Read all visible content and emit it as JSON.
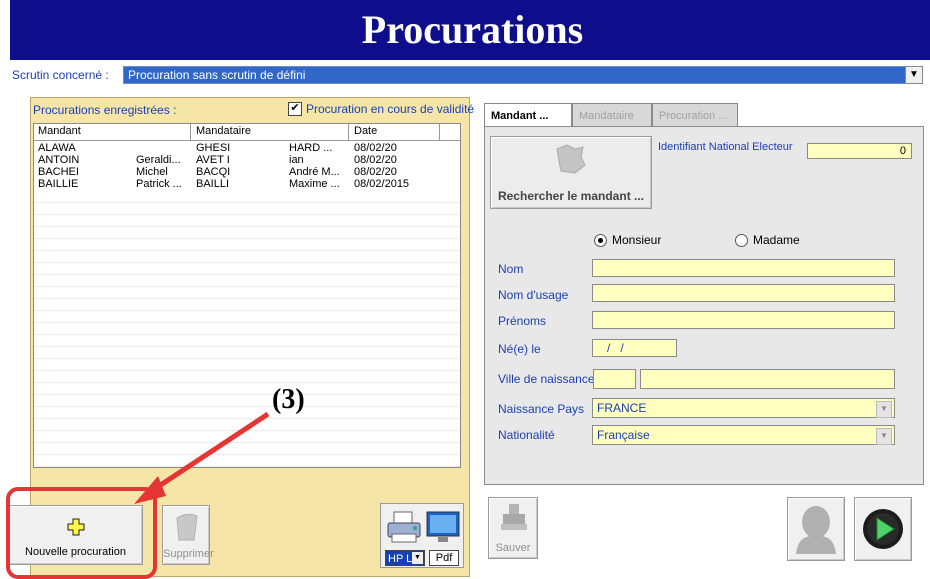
{
  "title": "Procurations",
  "scrutin": {
    "label": "Scrutin concerné :",
    "value": "Procuration sans scrutin de défini"
  },
  "left": {
    "label": "Procurations enregistrées :",
    "checkbox_label": "Procuration en cours de validité",
    "checked": true,
    "columns": [
      "Mandant",
      "Mandataire",
      "Date"
    ],
    "rows": [
      [
        "ALAWA",
        "",
        "GHESI",
        "HARD ...",
        "08/02/20"
      ],
      [
        "ANTOIN",
        "Geraldi...",
        "AVET I",
        "ian",
        "08/02/20"
      ],
      [
        "BACHEI",
        "Michel",
        "BACQI",
        "André M...",
        "08/02/20"
      ],
      [
        "BAILLIE",
        "Patrick ...",
        "BAILLI",
        "Maxime ...",
        "08/02/2015"
      ]
    ]
  },
  "buttons": {
    "new": "Nouvelle procuration",
    "delete": "Supprimer",
    "printer": "HP La",
    "pdf": "Pdf",
    "save": "Sauver"
  },
  "annotation": "(3)",
  "tabs": [
    "Mandant ...",
    "Mandataire ...",
    "Procuration ..."
  ],
  "right": {
    "search_button": "Rechercher le mandant ...",
    "id_label": "Identifiant National Electeur",
    "id_value": "0",
    "radio_monsieur": "Monsieur",
    "radio_madame": "Madame",
    "fields": {
      "nom": "Nom",
      "nom_usage": "Nom d'usage",
      "prenoms": "Prénoms",
      "ne_le": "Né(e) le",
      "date_value": "/   /",
      "ville": "Ville de naissance",
      "pays": "Naissance Pays",
      "pays_value": "FRANCE",
      "nationalite": "Nationalité",
      "nationalite_value": "Française"
    }
  },
  "colors": {
    "titlebar": "#0e0e8c",
    "panel": "#f5e6a8",
    "field": "#ffffc0",
    "highlight": "#e53535"
  }
}
